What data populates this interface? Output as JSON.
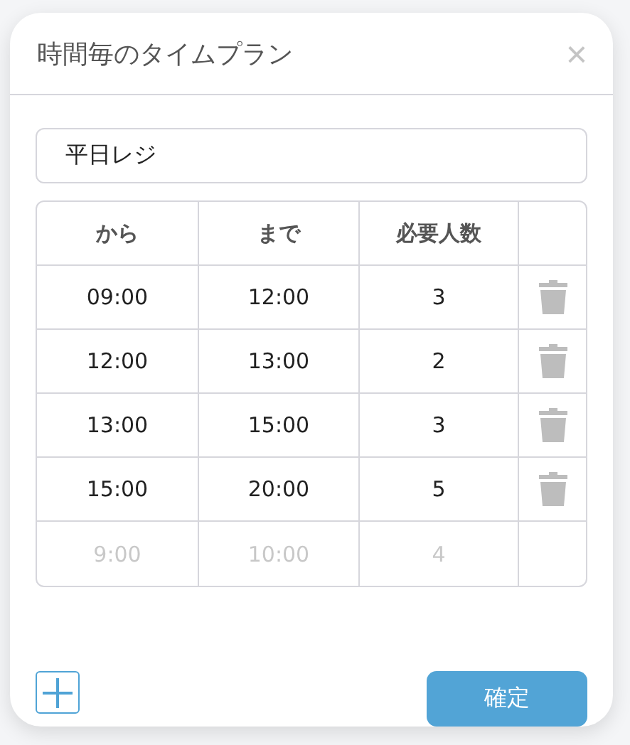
{
  "dialog": {
    "title": "時間毎のタイムプラン",
    "close": "×"
  },
  "name_field": {
    "value": "平日レジ"
  },
  "table": {
    "columns": [
      "から",
      "まで",
      "必要人数"
    ],
    "rows": [
      {
        "cells": [
          "09:00",
          "12:00",
          "3"
        ]
      },
      {
        "cells": [
          "12:00",
          "13:00",
          "2"
        ]
      },
      {
        "cells": [
          "13:00",
          "15:00",
          "3"
        ]
      },
      {
        "cells": [
          "15:00",
          "20:00",
          "5"
        ]
      }
    ],
    "new_row": {
      "placeholders": [
        "9:00",
        "10:00",
        "4"
      ]
    }
  },
  "confirm_button": "確定"
}
